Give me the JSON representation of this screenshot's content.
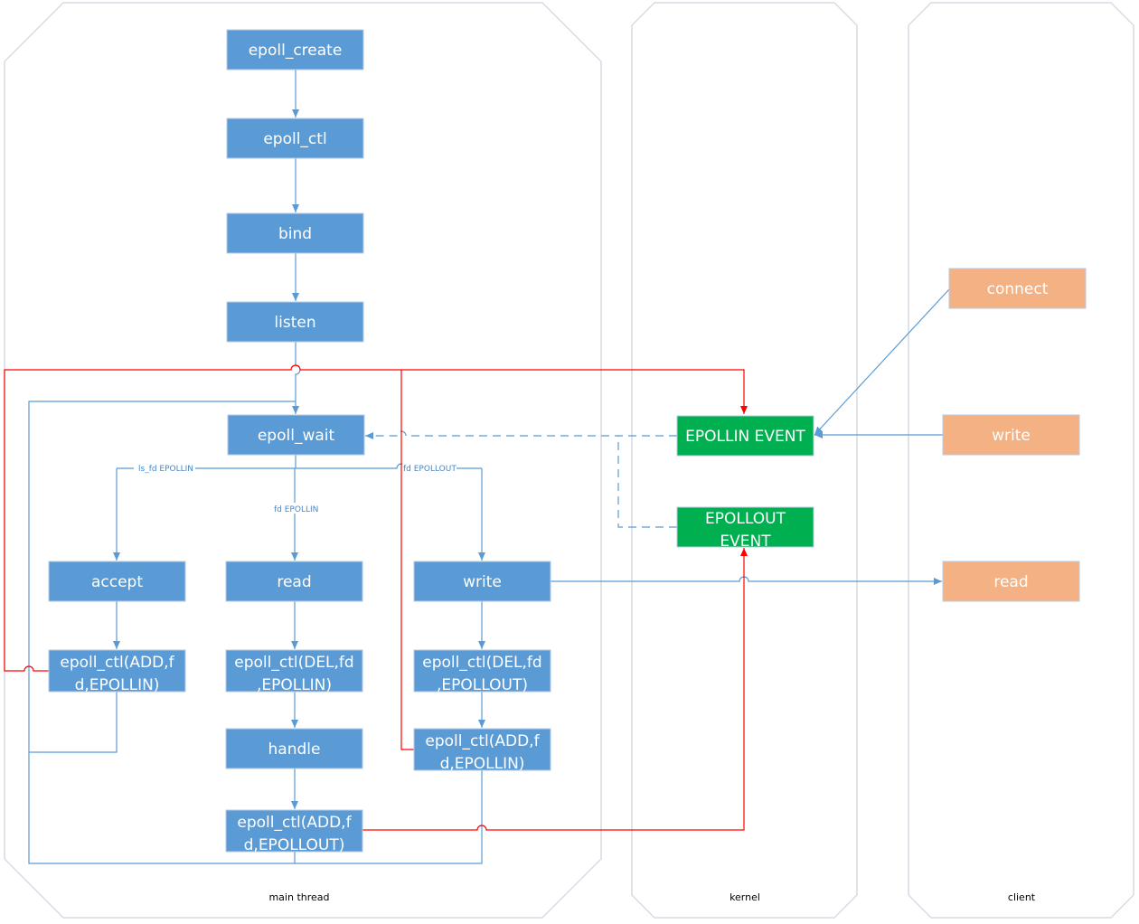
{
  "lanes": {
    "main": "main thread",
    "kernel": "kernel",
    "client": "client"
  },
  "nodes": {
    "epoll_create": [
      "epoll_create"
    ],
    "epoll_ctl": [
      "epoll_ctl"
    ],
    "bind": [
      "bind"
    ],
    "listen": [
      "listen"
    ],
    "epoll_wait": [
      "epoll_wait"
    ],
    "accept": [
      "accept"
    ],
    "read": [
      "read"
    ],
    "write": [
      "write"
    ],
    "ctl_add_in_accept": [
      "epoll_ctl(ADD,f",
      "d,EPOLLIN)"
    ],
    "ctl_del_in": [
      "epoll_ctl(DEL,fd",
      ",EPOLLIN)"
    ],
    "ctl_del_out": [
      "epoll_ctl(DEL,fd",
      ",EPOLLOUT)"
    ],
    "handle": [
      "handle"
    ],
    "ctl_add_in_write": [
      "epoll_ctl(ADD,f",
      "d,EPOLLIN)"
    ],
    "ctl_add_out": [
      "epoll_ctl(ADD,f",
      "d,EPOLLOUT)"
    ],
    "epollin_event": [
      "EPOLLIN EVENT"
    ],
    "epollout_event": [
      "EPOLLOUT",
      "EVENT"
    ],
    "client_connect": [
      "connect"
    ],
    "client_write": [
      "write"
    ],
    "client_read": [
      "read"
    ]
  },
  "edge_labels": {
    "ls_fd_epollin": "ls_fd  EPOLLIN",
    "fd_epollin": "fd EPOLLIN",
    "fd_epollout": "fd EPOLLOUT"
  },
  "colors": {
    "process": "#5b9bd5",
    "event": "#00b050",
    "client": "#f4b183",
    "event_flow": "#ff0000"
  }
}
